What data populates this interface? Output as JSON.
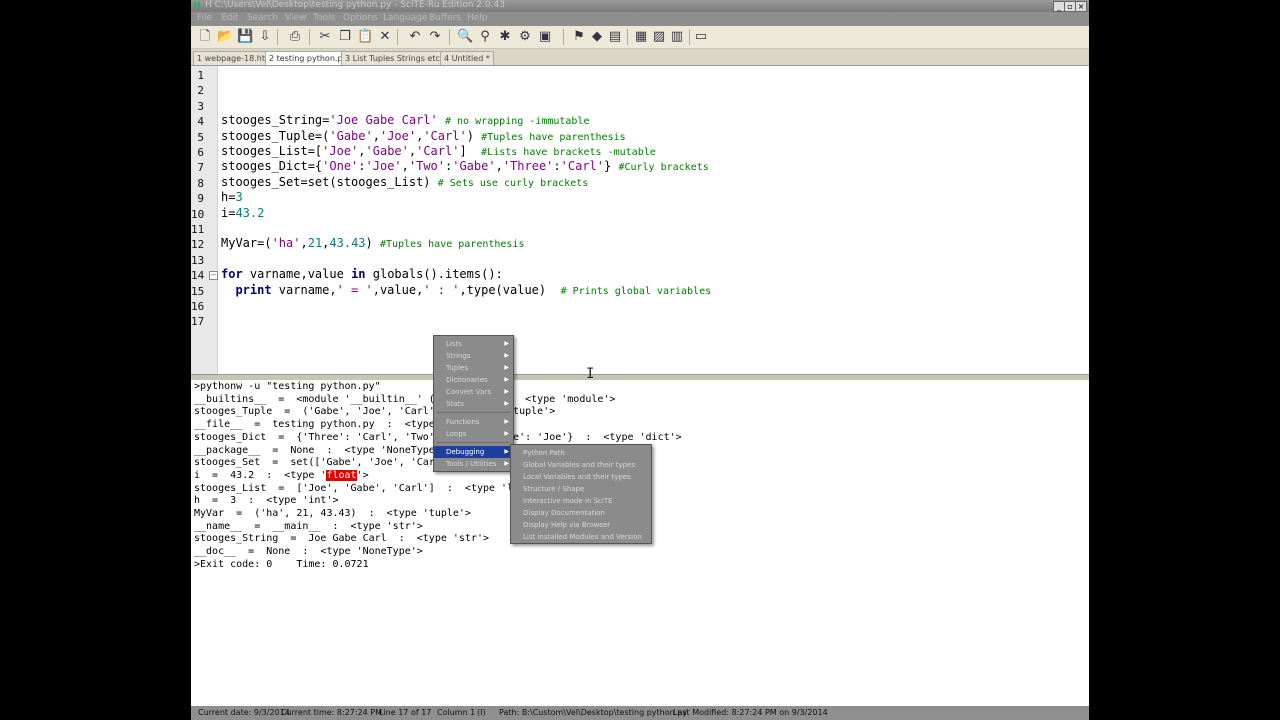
{
  "window": {
    "title": "H  C:\\Users\\Vel\\Desktop\\testing python.py - SciTE-Ru Edition 2.0.43",
    "icon": "H",
    "buttons": [
      "_",
      "▫",
      "×"
    ]
  },
  "menubar": [
    "File",
    "Edit",
    "Search",
    "View",
    "Tools",
    "Options",
    "Language",
    "Buffers",
    "Help"
  ],
  "toolbar_icons": [
    "new-file-icon",
    "open-folder-icon",
    "save-icon",
    "save-as-icon",
    "print-icon",
    "cut-icon",
    "copy-icon",
    "paste-icon",
    "delete-icon",
    "undo-icon",
    "redo-icon",
    "find-icon",
    "replace-icon",
    "bookmark-icon",
    "macro-icon",
    "run-icon",
    "compile-icon",
    "build-icon",
    "gear-icon",
    "folder-icon",
    "tools-icon",
    "stop-icon",
    "help-icon"
  ],
  "tabs": [
    {
      "label": "1 webpage-18.html",
      "active": false
    },
    {
      "label": "2 testing python.py",
      "active": true
    },
    {
      "label": "3 List Tuples Strings etc.py",
      "active": false
    },
    {
      "label": "4 Untitled *",
      "active": false
    }
  ],
  "editor": {
    "line_numbers": [
      "1",
      "2",
      "3",
      "4",
      "5",
      "6",
      "7",
      "8",
      "9",
      "10",
      "11",
      "12",
      "13",
      "14",
      "15",
      "16",
      "17"
    ],
    "lines": [
      {
        "tokens": []
      },
      {
        "tokens": []
      },
      {
        "tokens": []
      },
      {
        "tokens": [
          {
            "t": "stooges_String=",
            "c": ""
          },
          {
            "t": "'Joe Gabe Carl'",
            "c": "s"
          },
          {
            "t": " ",
            "c": ""
          },
          {
            "t": "# no wrapping -immutable",
            "c": "c"
          }
        ]
      },
      {
        "tokens": [
          {
            "t": "stooges_Tuple=(",
            "c": ""
          },
          {
            "t": "'Gabe'",
            "c": "s"
          },
          {
            "t": ",",
            "c": ""
          },
          {
            "t": "'Joe'",
            "c": "s"
          },
          {
            "t": ",",
            "c": ""
          },
          {
            "t": "'Carl'",
            "c": "s"
          },
          {
            "t": ") ",
            "c": ""
          },
          {
            "t": "#Tuples have parenthesis",
            "c": "c"
          }
        ]
      },
      {
        "tokens": [
          {
            "t": "stooges_List=[",
            "c": ""
          },
          {
            "t": "'Joe'",
            "c": "s"
          },
          {
            "t": ",",
            "c": ""
          },
          {
            "t": "'Gabe'",
            "c": "s"
          },
          {
            "t": ",",
            "c": ""
          },
          {
            "t": "'Carl'",
            "c": "s"
          },
          {
            "t": "]  ",
            "c": ""
          },
          {
            "t": "#Lists have brackets -mutable",
            "c": "c"
          }
        ]
      },
      {
        "tokens": [
          {
            "t": "stooges_Dict={",
            "c": ""
          },
          {
            "t": "'One'",
            "c": "s"
          },
          {
            "t": ":",
            "c": ""
          },
          {
            "t": "'Joe'",
            "c": "s"
          },
          {
            "t": ",",
            "c": ""
          },
          {
            "t": "'Two'",
            "c": "s"
          },
          {
            "t": ":",
            "c": ""
          },
          {
            "t": "'Gabe'",
            "c": "s"
          },
          {
            "t": ",",
            "c": ""
          },
          {
            "t": "'Three'",
            "c": "s"
          },
          {
            "t": ":",
            "c": ""
          },
          {
            "t": "'Carl'",
            "c": "s"
          },
          {
            "t": "} ",
            "c": ""
          },
          {
            "t": "#Curly brackets",
            "c": "c"
          }
        ]
      },
      {
        "tokens": [
          {
            "t": "stooges_Set=set(stooges_List) ",
            "c": ""
          },
          {
            "t": "# Sets use curly brackets",
            "c": "c"
          }
        ]
      },
      {
        "tokens": [
          {
            "t": "h=",
            "c": ""
          },
          {
            "t": "3",
            "c": "n"
          }
        ]
      },
      {
        "tokens": [
          {
            "t": "i=",
            "c": ""
          },
          {
            "t": "43.2",
            "c": "n"
          }
        ]
      },
      {
        "tokens": []
      },
      {
        "tokens": [
          {
            "t": "MyVar=(",
            "c": ""
          },
          {
            "t": "'ha'",
            "c": "s"
          },
          {
            "t": ",",
            "c": ""
          },
          {
            "t": "21",
            "c": "n"
          },
          {
            "t": ",",
            "c": ""
          },
          {
            "t": "43.43",
            "c": "n"
          },
          {
            "t": ") ",
            "c": ""
          },
          {
            "t": "#Tuples have parenthesis",
            "c": "c"
          }
        ]
      },
      {
        "tokens": []
      },
      {
        "tokens": [
          {
            "t": "for",
            "c": "k"
          },
          {
            "t": " varname,value ",
            "c": ""
          },
          {
            "t": "in",
            "c": "k"
          },
          {
            "t": " globals().items():",
            "c": ""
          }
        ]
      },
      {
        "tokens": [
          {
            "t": "  ",
            "c": ""
          },
          {
            "t": "print",
            "c": "k"
          },
          {
            "t": " varname,",
            "c": ""
          },
          {
            "t": "' = '",
            "c": "s"
          },
          {
            "t": ",value,",
            "c": ""
          },
          {
            "t": "' : '",
            "c": "s"
          },
          {
            "t": ",type(value)  ",
            "c": ""
          },
          {
            "t": "# Prints global variables",
            "c": "c"
          }
        ]
      },
      {
        "tokens": []
      },
      {
        "tokens": []
      }
    ]
  },
  "output": {
    "lines": [
      ">pythonw -u \"testing python.py\"",
      "__builtins__  =  <module '__builtin__' (built-in)>  :  <type 'module'>",
      "stooges_Tuple  =  ('Gabe', 'Joe', 'Carl')  :  <type 'tuple'>",
      "__file__  =  testing python.py  :  <type 'str'>",
      "stooges_Dict  =  {'Three': 'Carl', 'Two': 'Gabe', 'One': 'Joe'}  :  <type 'dict'>",
      "__package__  =  None  :  <type 'NoneType'>",
      "stooges_Set  =  set(['Gabe', 'Joe', 'Carl'])  :  <type 'set'>",
      "i  =  43.2  :  <type 'float'>",
      "stooges_List  =  ['Joe', 'Gabe', 'Carl']  :  <type 'list'>",
      "h  =  3  :  <type 'int'>",
      "MyVar  =  ('ha', 21, 43.43)  :  <type 'tuple'>",
      "__name__  =  __main__  :  <type 'str'>",
      "stooges_String  =  Joe Gabe Carl  :  <type 'str'>",
      "__doc__  =  None  :  <type 'NoneType'>",
      ">Exit code: 0    Time: 0.0721"
    ],
    "highlight_word": "float"
  },
  "context_menu": {
    "items": [
      {
        "label": "Lists",
        "submenu": true
      },
      {
        "label": "Strings",
        "submenu": true
      },
      {
        "label": "Tuples",
        "submenu": true
      },
      {
        "label": "Dictionaries",
        "submenu": true
      },
      {
        "label": "Convert Vars",
        "submenu": true
      },
      {
        "label": "Stats",
        "submenu": true
      },
      {
        "label": "Functions",
        "submenu": true
      },
      {
        "label": "Loops",
        "submenu": true
      },
      {
        "label": "Debugging",
        "submenu": true,
        "active": true
      },
      {
        "label": "Tools / Utilities",
        "submenu": true
      }
    ]
  },
  "submenu": {
    "items": [
      "Python Path",
      "Global Variables and their types",
      "Local Variables and their types",
      "Structure / Shape",
      "Interactive mode in SciTE",
      "Display Documentation",
      "Display Help via Browser",
      "List installed Modules and Version"
    ]
  },
  "statusbar": {
    "date": "Current date: 9/3/2014",
    "time": "Current time: 8:27:24 PM",
    "line": "Line 17 of 17",
    "column": "Column 1",
    "mode": "(I)",
    "path": "Path: B:\\Custom\\Vel\\Desktop\\testing python.py",
    "modified": "Last Modified: 8:27:24 PM on 9/3/2014"
  }
}
